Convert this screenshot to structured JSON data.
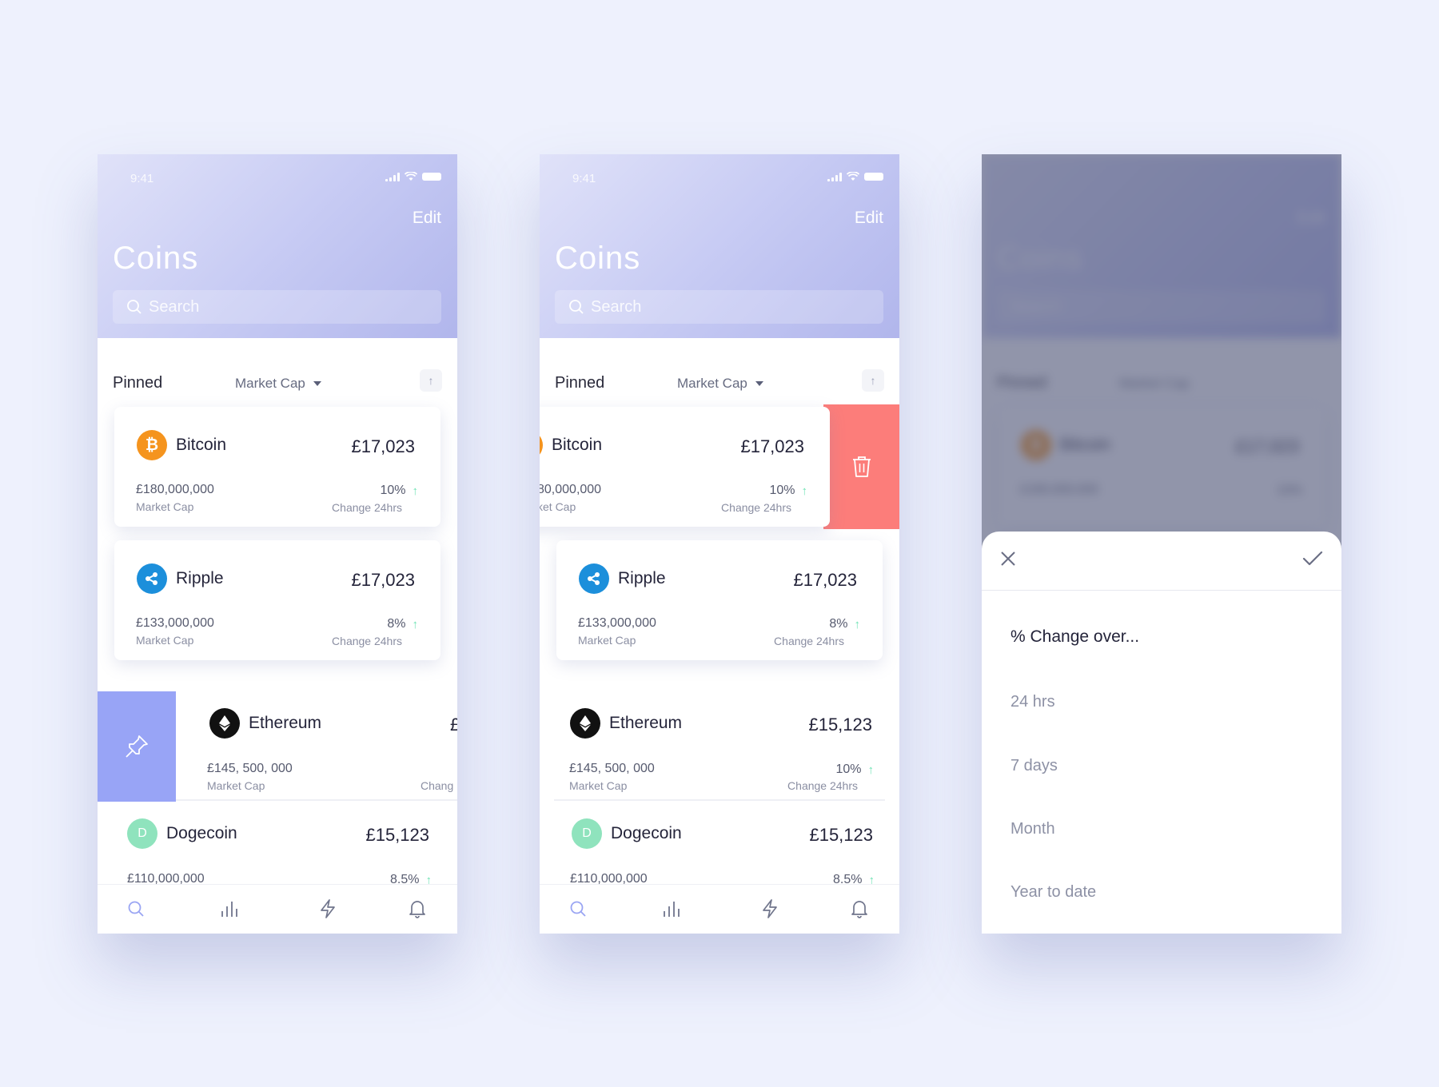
{
  "status": {
    "time": "9:41"
  },
  "header": {
    "edit_label": "Edit",
    "title": "Coins",
    "search_placeholder": "Search"
  },
  "sort": {
    "pinned_label": "Pinned",
    "market_cap_label": "Market Cap"
  },
  "coins": [
    {
      "name": "Bitcoin",
      "price": "£17,023",
      "market_cap": "£180,000,000",
      "market_cap_label": "Market Cap",
      "change": "10%",
      "change_label": "Change 24hrs",
      "icon": "bitcoin-icon"
    },
    {
      "name": "Ripple",
      "price": "£17,023",
      "market_cap": "£133,000,000",
      "market_cap_label": "Market Cap",
      "change": "8%",
      "change_label": "Change 24hrs",
      "icon": "ripple-icon"
    },
    {
      "name": "Ethereum",
      "price": "£15,123",
      "market_cap": "£145, 500, 000",
      "market_cap_label": "Market Cap",
      "change": "10%",
      "change_label": "Change 24hrs",
      "icon": "ethereum-icon"
    },
    {
      "name": "Dogecoin",
      "price": "£15,123",
      "market_cap": "£110,000,000",
      "change": "8.5%",
      "icon": "dogecoin-icon",
      "icon_letter": "D"
    }
  ],
  "clipped": {
    "eth_price_partial": "£",
    "eth_change_partial": "Chang",
    "btc_mcap_partial": "80,000,000",
    "btc_mcap_label_partial": "ket Cap"
  },
  "tabs": [
    "search-tab",
    "charts-tab",
    "activity-tab",
    "notifications-tab"
  ],
  "sheet": {
    "title": "% Change over...",
    "options": [
      "24 hrs",
      "7 days",
      "Month",
      "Year to date"
    ]
  },
  "colors": {
    "accent": "#98a4f6",
    "delete": "#fc7d7a",
    "up_arrow": "#6fe3b4",
    "bitcoin": "#f5941e",
    "ripple": "#1c8fdb",
    "dogecoin": "#8fe3bd"
  }
}
